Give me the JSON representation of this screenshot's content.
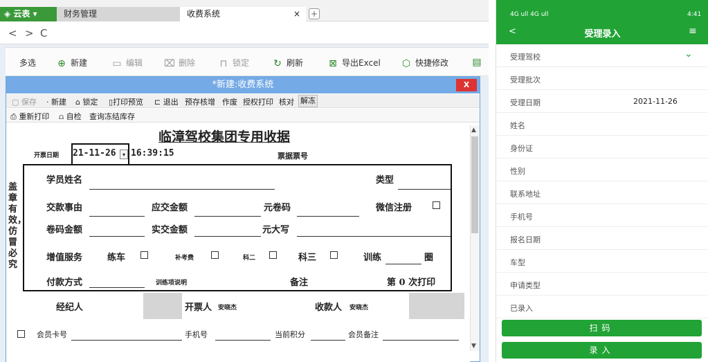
{
  "browser": {
    "logo": "云表",
    "tabs": [
      "财务管理",
      "收费系统"
    ],
    "close": "×",
    "newtab": "+",
    "nav": {
      "back": "<",
      "forward": ">",
      "reload": "C"
    }
  },
  "toolbar": [
    {
      "label": "多选",
      "icon": "",
      "disabled": false
    },
    {
      "label": "新建",
      "icon": "plus-circle-icon",
      "disabled": false
    },
    {
      "label": "编辑",
      "icon": "folder-icon",
      "disabled": true
    },
    {
      "label": "删除",
      "icon": "delete-icon",
      "disabled": true
    },
    {
      "label": "锁定",
      "icon": "lock-icon",
      "disabled": true
    },
    {
      "label": "刷新",
      "icon": "refresh-icon",
      "disabled": false
    },
    {
      "label": "导出Excel",
      "icon": "excel-icon",
      "disabled": false
    },
    {
      "label": "快捷修改",
      "icon": "hexagon-icon",
      "disabled": false
    }
  ],
  "dialog": {
    "title": "*新建:收费系统",
    "close": "X",
    "toolbar1": [
      {
        "label": "保存",
        "disabled": true
      },
      {
        "label": "新建",
        "disabled": false
      },
      {
        "label": "锁定",
        "disabled": false
      },
      {
        "label": "打印预览",
        "disabled": false
      },
      {
        "label": "退出",
        "disabled": false
      },
      {
        "label": "预存核增",
        "disabled": false
      },
      {
        "label": "作废",
        "disabled": false
      },
      {
        "label": "授权打印",
        "disabled": false
      },
      {
        "label": "核对",
        "disabled": false
      },
      {
        "label": "解冻",
        "disabled": false
      }
    ],
    "toolbar2": [
      "重新打印",
      "自检",
      "查询冻结库存"
    ]
  },
  "form": {
    "title": "临漳驾校集团专用收据",
    "issue_date_label": "开票日期",
    "issue_date": "21-11-26",
    "issue_time": "16:39:15",
    "receipt_no_label": "票据票号",
    "side_note": "盖章有效，仿冒必究",
    "student_name": "学员姓名",
    "type": "类型",
    "pay_reason": "交款事由",
    "amount_due": "应交金额",
    "coupon_code": "元卷码",
    "wechat_reg": "微信注册",
    "coupon_amount": "卷码金额",
    "amount_paid": "实交金额",
    "yuan_upper": "元大写",
    "value_added": "增值服务",
    "practice": "练车",
    "retake_fee": "补考费",
    "subject2": "科二",
    "subject3": "科三",
    "training": "训练",
    "laps": "圈",
    "pay_method": "付款方式",
    "training_desc": "训练项说明",
    "remarks": "备注",
    "print_count_prefix": "第",
    "print_count": "0",
    "print_count_suffix": "次打印",
    "agent": "经纪人",
    "issuer_label": "开票人",
    "issuer": "安晓杰",
    "payee_label": "收款人",
    "payee": "安晓杰",
    "member_card": "会员卡号",
    "phone": "手机号",
    "points": "当前积分",
    "member_note": "会员备注"
  },
  "phone": {
    "status_left": "4G ull 4G ull",
    "status_right": "4:41",
    "back": "<",
    "title": "受理录入",
    "menu": "≡",
    "rows": [
      {
        "label": "受理驾校",
        "value": ""
      },
      {
        "label": "受理批次",
        "value": ""
      },
      {
        "label": "受理日期",
        "value": "2021-11-26"
      },
      {
        "label": "姓名",
        "value": ""
      },
      {
        "label": "身份证",
        "value": ""
      },
      {
        "label": "性别",
        "value": ""
      },
      {
        "label": "联系地址",
        "value": ""
      },
      {
        "label": "手机号",
        "value": ""
      },
      {
        "label": "报名日期",
        "value": ""
      },
      {
        "label": "车型",
        "value": ""
      },
      {
        "label": "申请类型",
        "value": ""
      },
      {
        "label": "已录入",
        "value": ""
      }
    ],
    "scan_button": "扫码",
    "enter_button": "录入",
    "accent": "#21a336"
  }
}
